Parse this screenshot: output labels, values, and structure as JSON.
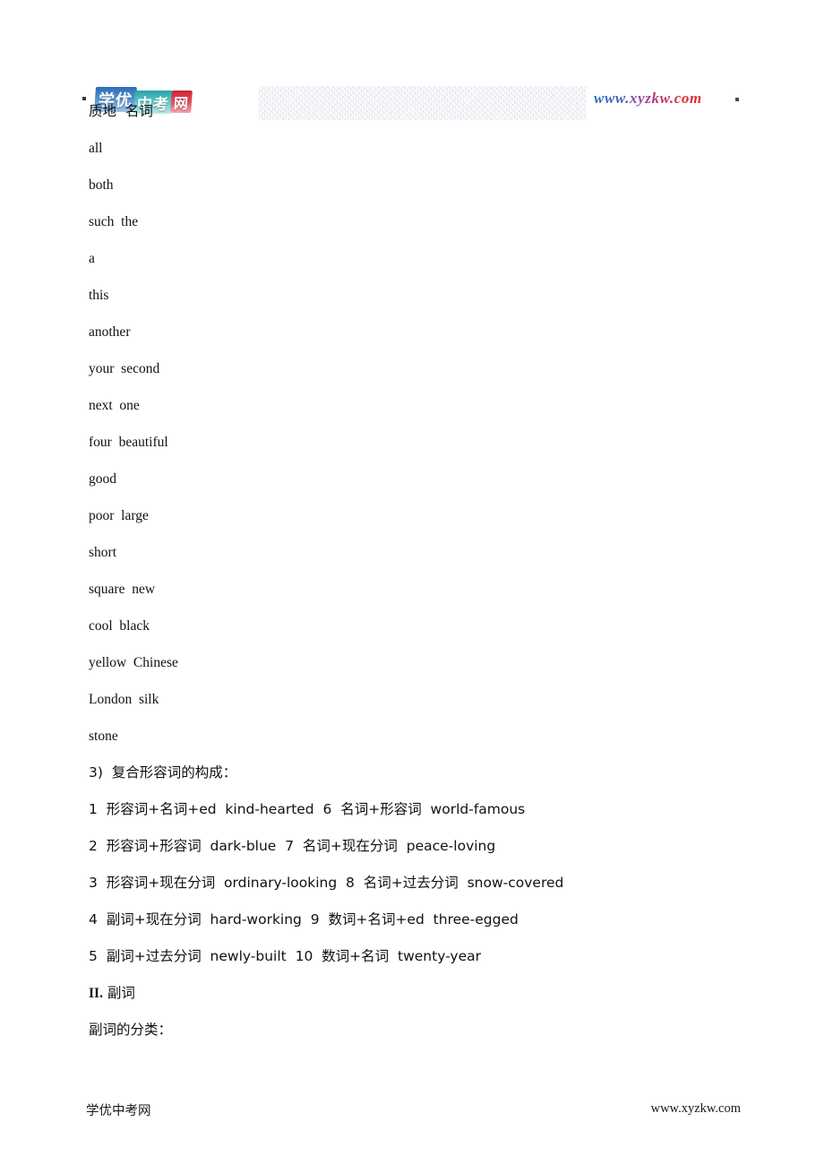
{
  "header": {
    "logo": {
      "alt": "学优中考网",
      "tiles": [
        {
          "text": "学优",
          "color": "#4e8fd0"
        },
        {
          "text": "中考",
          "color": "#5ec7c8"
        },
        {
          "text": "网",
          "color": "#e4515f"
        }
      ]
    },
    "url": "www.xyzkw.com",
    "dot_left": "·",
    "dot_right": "·"
  },
  "content": {
    "word_lines": [
      "质地  名词",
      "all",
      "both",
      "such  the",
      "a",
      "this",
      "another",
      "your  second",
      "next  one",
      "four  beautiful",
      "good",
      "poor  large",
      "short",
      "square  new",
      "cool  black",
      "yellow  Chinese",
      "London  silk",
      "stone"
    ],
    "compound_heading": "3)  复合形容词的构成：",
    "compound_rules": [
      "1  形容词+名词+ed  kind-hearted  6  名词+形容词  world-famous",
      "2  形容词+形容词  dark-blue  7  名词+现在分词  peace-loving",
      "3  形容词+现在分词  ordinary-looking  8  名词+过去分词  snow-covered",
      "4  副词+现在分词  hard-working  9  数词+名词+ed  three-egged",
      "5  副词+过去分词  newly-built  10  数词+名词  twenty-year"
    ],
    "adverb_section_numeral": "II.",
    "adverb_section_title": " 副词",
    "adverb_classification": "副词的分类："
  },
  "footer": {
    "left": "学优中考网",
    "right": "www.xyzkw.com"
  }
}
